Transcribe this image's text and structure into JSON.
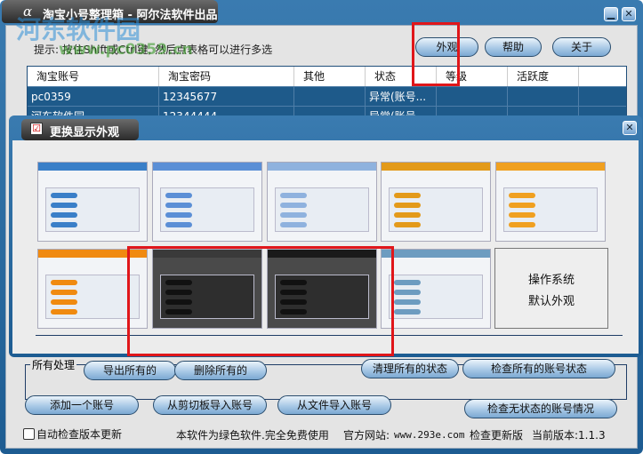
{
  "window": {
    "title": "淘宝小号整理箱 - 阿尔法软件出品",
    "logo": "α",
    "minimize": "▁",
    "close": "✕"
  },
  "watermark": {
    "name": "河东软件园",
    "url": "www.pc0359.cn"
  },
  "hint": "提示: 按住Shift或Ctrl键, 然后点表格可以进行多选",
  "top_buttons": {
    "appearance": "外观",
    "help": "帮助",
    "about": "关于"
  },
  "table": {
    "columns": [
      "淘宝账号",
      "淘宝密码",
      "其他",
      "状态",
      "等级",
      "活跃度"
    ],
    "rows": [
      [
        "pc0359",
        "12345677",
        "",
        "异常(账号...",
        "",
        ""
      ],
      [
        "河东软件园",
        "12344444",
        "",
        "异常(账号...",
        "",
        ""
      ]
    ]
  },
  "dialog": {
    "title": "更换显示外观",
    "check": "☑",
    "close": "✕",
    "system_default": [
      "操作系统",
      "默认外观"
    ],
    "themes": [
      {
        "name": "theme-blue-1",
        "color": "#3a7fc8"
      },
      {
        "name": "theme-blue-2",
        "color": "#5b8fd6"
      },
      {
        "name": "theme-light-blue",
        "color": "#8fb2de"
      },
      {
        "name": "theme-orange-1",
        "color": "#e39a1a"
      },
      {
        "name": "theme-orange-2",
        "color": "#f0a020"
      },
      {
        "name": "theme-orange-3",
        "color": "#f08a10"
      },
      {
        "name": "theme-dark-1",
        "color": "#3a3a3a"
      },
      {
        "name": "theme-black",
        "color": "#1a1a1a"
      },
      {
        "name": "theme-steel",
        "color": "#6d9cc0"
      }
    ]
  },
  "all_group": {
    "label": "所有处理",
    "export": "导出所有的",
    "delete": "删除所有的",
    "clear_status": "清理所有的状态",
    "check_all": "检查所有的账号状态"
  },
  "actions": {
    "add": "添加一个账号",
    "from_clipboard": "从剪切板导入账号",
    "from_file": "从文件导入账号",
    "check_no_status": "检查无状态的账号情况"
  },
  "footer": {
    "auto_check": "自动检查版本更新",
    "auto_check_checked": false,
    "free": "本软件为绿色软件.完全免费使用",
    "site_label": "官方网站:",
    "site": "www.293e.com",
    "check_update": "检查更新版",
    "version": "当前版本:1.1.3"
  }
}
